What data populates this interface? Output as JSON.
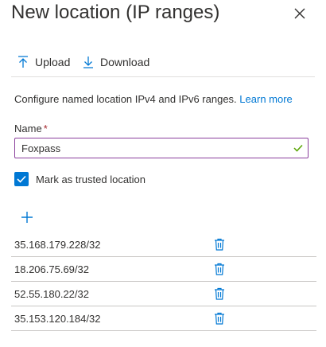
{
  "panel": {
    "title": "New location (IP ranges)"
  },
  "toolbar": {
    "upload_label": "Upload",
    "download_label": "Download"
  },
  "description": {
    "text": "Configure named location IPv4 and IPv6 ranges.",
    "link": "Learn more"
  },
  "name_field": {
    "label": "Name",
    "required_marker": "*",
    "value": "Foxpass"
  },
  "trusted": {
    "label": "Mark as trusted location",
    "checked": true
  },
  "ip_ranges": [
    "35.168.179.228/32",
    "18.206.75.69/32",
    "52.55.180.22/32",
    "35.153.120.184/32"
  ],
  "colors": {
    "accent": "#0078d4",
    "field_border": "#8a3f9c",
    "valid_check": "#57a300",
    "required": "#a4262c"
  }
}
